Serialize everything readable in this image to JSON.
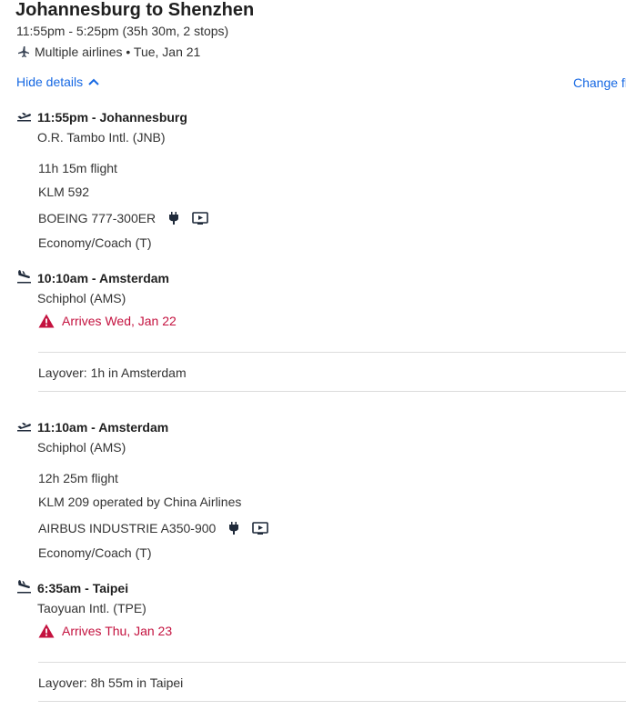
{
  "header": {
    "title": "Johannesburg to Shenzhen",
    "subtitle": "11:55pm - 5:25pm (35h 30m, 2 stops)",
    "airline_date": "Multiple airlines • Tue, Jan 21",
    "hide_details_label": "Hide details",
    "change_flight_label": "Change fl"
  },
  "segments": [
    {
      "departure_time_city": "11:55pm - Johannesburg",
      "departure_airport": "O.R. Tambo Intl. (JNB)",
      "duration": "11h 15m flight",
      "flight_number": "KLM 592",
      "aircraft": "BOEING 777-300ER",
      "cabin": "Economy/Coach (T)",
      "arrival_time_city": "10:10am - Amsterdam",
      "arrival_airport": "Schiphol (AMS)",
      "arrival_warning": "Arrives Wed, Jan 22"
    },
    {
      "departure_time_city": "11:10am - Amsterdam",
      "departure_airport": "Schiphol (AMS)",
      "duration": "12h 25m flight",
      "flight_number": "KLM 209 operated by China Airlines",
      "aircraft": "AIRBUS INDUSTRIE A350-900",
      "cabin": "Economy/Coach (T)",
      "arrival_time_city": "6:35am - Taipei",
      "arrival_airport": "Taoyuan Intl. (TPE)",
      "arrival_warning": "Arrives Thu, Jan 23"
    }
  ],
  "layovers": [
    "Layover: 1h in Amsterdam",
    "Layover: 8h 55m in Taipei"
  ],
  "icons": {
    "takeoff": "takeoff-icon",
    "landing": "landing-icon",
    "power": "power-outlet-icon",
    "entertainment": "entertainment-icon",
    "warning": "warning-icon",
    "chevron": "chevron-up-icon",
    "airlines": "multiple-airlines-icon"
  },
  "colors": {
    "link": "#1668e3",
    "warning": "#c4123f",
    "divider": "#dcdcdc"
  }
}
